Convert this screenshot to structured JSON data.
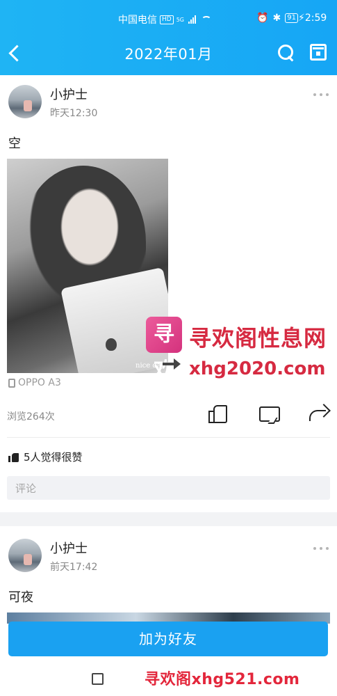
{
  "status_bar": {
    "carrier": "中国电信",
    "hd": "HD",
    "network": "5G",
    "battery": "91",
    "time": "2:59"
  },
  "header": {
    "title": "2022年01月"
  },
  "posts": [
    {
      "username": "小护士",
      "time": "昨天12:30",
      "text": "空",
      "photo_caption": "nice day",
      "device": "OPPO A3",
      "views": "浏览264次",
      "likes_text": "5人觉得很赞",
      "comment_placeholder": "评论"
    },
    {
      "username": "小护士",
      "time": "前天17:42",
      "text": "可夜"
    }
  ],
  "add_friend_label": "加为好友",
  "watermark": {
    "logo_text": "寻欢",
    "title": "寻欢阁性息网",
    "url": "xhg2020.com",
    "bottom": "寻欢阁xhg521.com"
  }
}
